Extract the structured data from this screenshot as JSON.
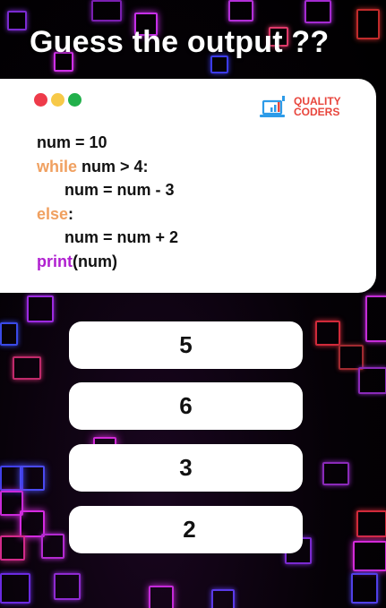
{
  "title": "Guess the output ??",
  "window_dots": [
    {
      "name": "red",
      "color": "#ee3b4a"
    },
    {
      "name": "yellow",
      "color": "#f7c948"
    },
    {
      "name": "green",
      "color": "#22b04b"
    }
  ],
  "logo": {
    "icon": "laptop-chart-icon",
    "line1": "QUALITY",
    "line2": "CODERS",
    "text_color": "#e8453c",
    "icon_color": "#2d9be8"
  },
  "code": {
    "keyword_orange": "#f0a060",
    "keyword_purple": "#b020d0",
    "lines": [
      {
        "keyword": "",
        "text": "num = 10"
      },
      {
        "keyword": "while",
        "text": " num > 4:"
      },
      {
        "keyword": "",
        "text": "num = num - 3"
      },
      {
        "keyword": "else",
        "text": ":"
      },
      {
        "keyword": "",
        "text": "num = num + 2"
      },
      {
        "keyword": "print",
        "text": "(num)"
      }
    ]
  },
  "options": [
    "5",
    "6",
    "3",
    "2"
  ]
}
